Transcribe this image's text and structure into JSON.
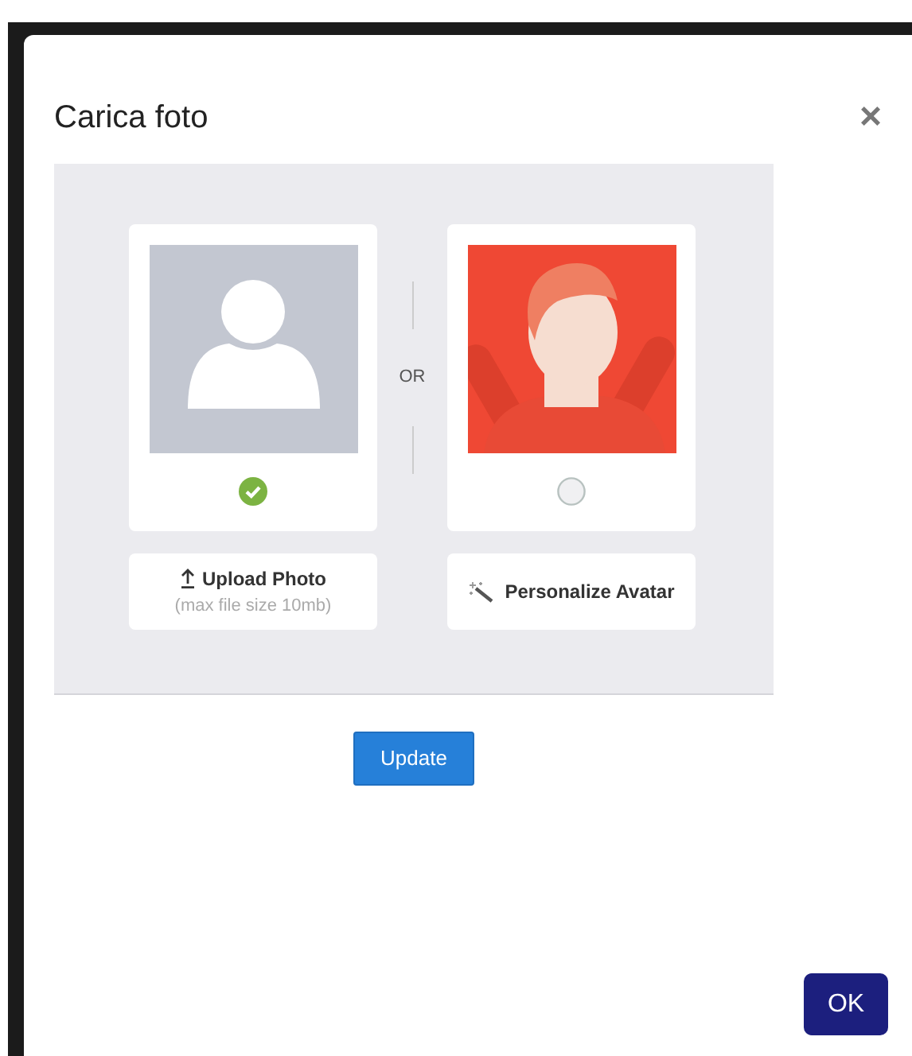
{
  "dialog": {
    "title": "Carica foto",
    "close": "×"
  },
  "options": [
    {
      "kind": "upload",
      "selected": true,
      "action": {
        "label": "Upload Photo",
        "hint": "(max file size 10mb)"
      }
    },
    {
      "kind": "avatar",
      "selected": false,
      "action": {
        "label": "Personalize Avatar"
      }
    }
  ],
  "separator": "OR",
  "update_button": "Update",
  "ok_button": "OK"
}
